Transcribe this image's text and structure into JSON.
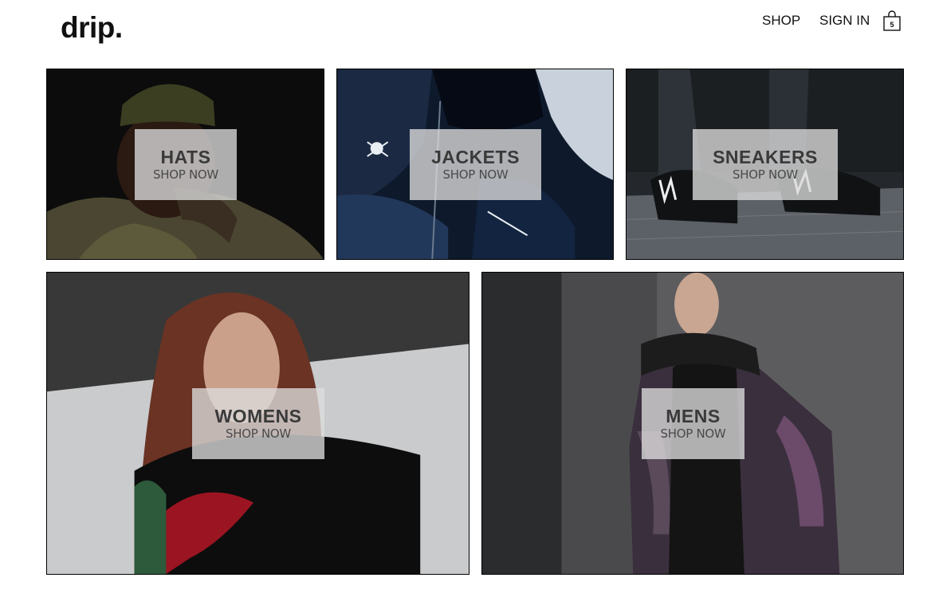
{
  "header": {
    "logo": "drip.",
    "nav": {
      "shop": "SHOP",
      "sign_in": "SIGN IN"
    },
    "cart": {
      "icon": "shopping-bag-icon",
      "count": "5"
    }
  },
  "categories": [
    {
      "title": "HATS",
      "cta": "SHOP NOW"
    },
    {
      "title": "JACKETS",
      "cta": "SHOP NOW"
    },
    {
      "title": "SNEAKERS",
      "cta": "SHOP NOW"
    },
    {
      "title": "WOMENS",
      "cta": "SHOP NOW"
    },
    {
      "title": "MENS",
      "cta": "SHOP NOW"
    }
  ],
  "colors": {
    "text": "#111111",
    "label_background": "#dcdcdc",
    "tile_border": "#000000"
  }
}
